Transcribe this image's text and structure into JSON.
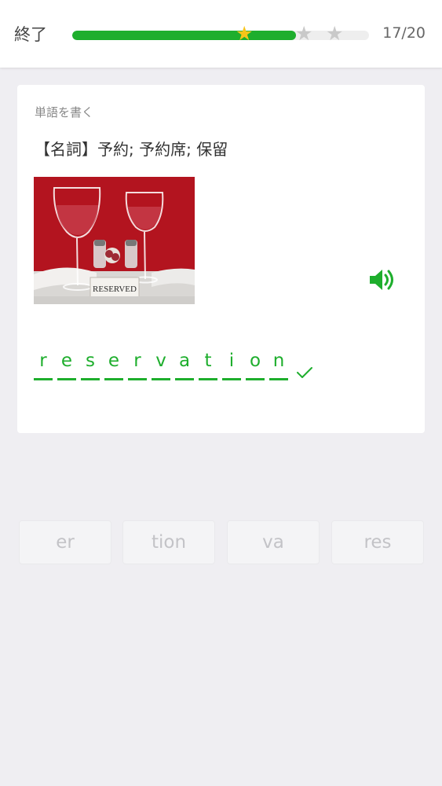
{
  "header": {
    "quit_label": "終了",
    "progress": 0.754,
    "counter": "17/20",
    "stars": [
      {
        "filled": true,
        "color": "#f7c51a"
      },
      {
        "filled": false,
        "color": "#c9c9c9"
      },
      {
        "filled": false,
        "color": "#c9c9c9"
      }
    ],
    "progress_color": "#1eae2d",
    "track_color": "#eeeeee"
  },
  "card": {
    "prompt_label": "単語を書く",
    "definition": "【名詞】予約; 予約席; 保留",
    "image_sign_text": "RESERVED",
    "audio_icon": "speaker-icon",
    "answer_letters": [
      "r",
      "e",
      "s",
      "e",
      "r",
      "v",
      "a",
      "t",
      "i",
      "o",
      "n"
    ],
    "answer_status": "correct",
    "accent_color": "#1eae2d"
  },
  "tiles": [
    {
      "label": "er"
    },
    {
      "label": "tion"
    },
    {
      "label": "va"
    },
    {
      "label": "res"
    }
  ]
}
